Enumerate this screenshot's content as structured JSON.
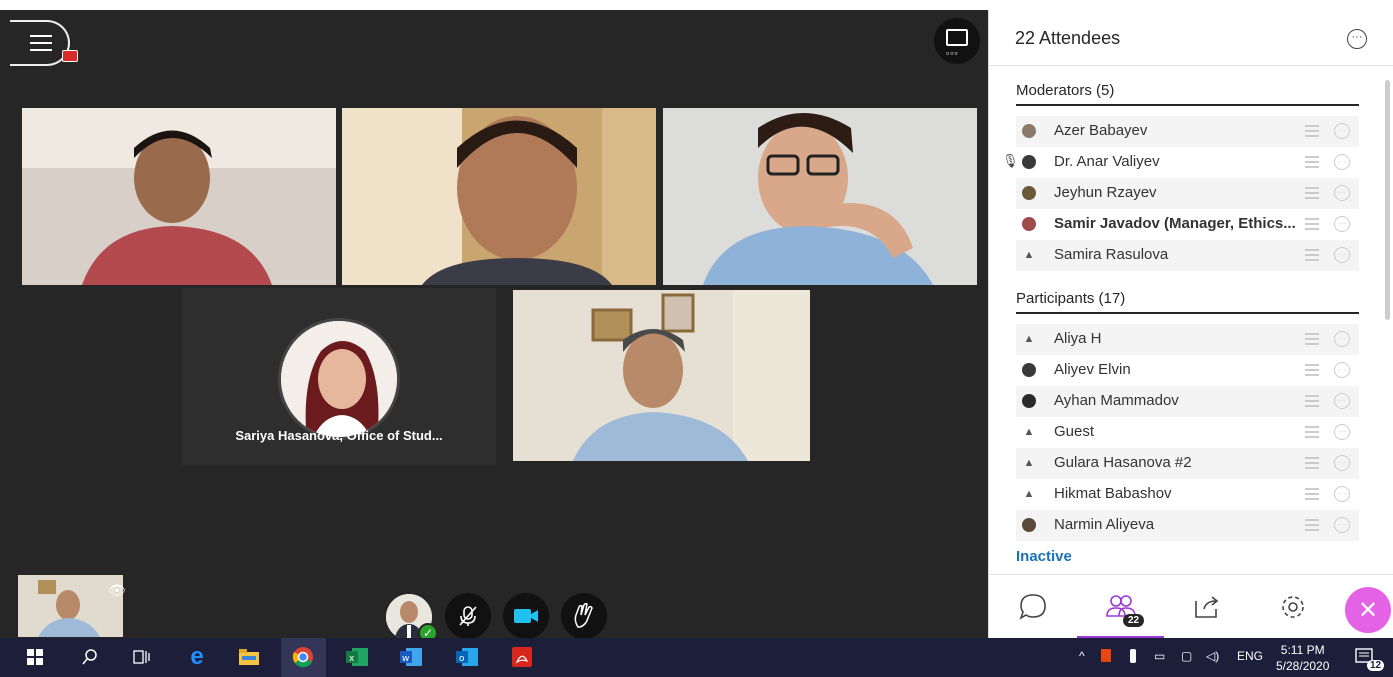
{
  "meeting": {
    "tiles": [
      {
        "kind": "video",
        "bg": "#8a7c72"
      },
      {
        "kind": "video",
        "bg": "#a88a5c"
      },
      {
        "kind": "video",
        "bg": "#c8c9c7"
      },
      {
        "kind": "avatar",
        "name": "Sariya Hasanova, Office of Stud..."
      },
      {
        "kind": "video",
        "bg": "#d8d3c6"
      }
    ],
    "controls": {
      "mic_icon": "mic-off-icon",
      "camera_icon": "camera-icon",
      "hand_icon": "raise-hand-icon"
    }
  },
  "panel": {
    "title": "22 Attendees",
    "moderators_label": "Moderators (5)",
    "moderators": [
      {
        "name": "Azer Babayev",
        "bold": false,
        "avatar": "#8a7a6a",
        "mic": false
      },
      {
        "name": "Dr. Anar Valiyev",
        "bold": false,
        "avatar": "#3a3a3a",
        "mic": true
      },
      {
        "name": "Jeyhun Rzayev",
        "bold": false,
        "avatar": "#6a5a3a",
        "mic": false
      },
      {
        "name": "Samir Javadov (Manager, Ethics...",
        "bold": true,
        "avatar": "#a04a4a",
        "mic": false
      },
      {
        "name": "Samira Rasulova",
        "bold": false,
        "avatar": "generic",
        "mic": false
      }
    ],
    "participants_label": "Participants (17)",
    "participants": [
      {
        "name": "Aliya H",
        "bold": false,
        "avatar": "generic"
      },
      {
        "name": "Aliyev Elvin",
        "bold": false,
        "avatar": "#3a3a3a"
      },
      {
        "name": "Ayhan Mammadov",
        "bold": false,
        "avatar": "#2a2a2a"
      },
      {
        "name": "Guest",
        "bold": false,
        "avatar": "generic"
      },
      {
        "name": "Gulara Hasanova #2",
        "bold": false,
        "avatar": "generic"
      },
      {
        "name": "Hikmat Babashov",
        "bold": false,
        "avatar": "generic"
      },
      {
        "name": "Narmin Aliyeva",
        "bold": false,
        "avatar": "#5a4a3a"
      }
    ],
    "inactive_label": "Inactive",
    "attendee_badge": "22"
  },
  "taskbar": {
    "language": "ENG",
    "time": "5:11 PM",
    "date": "5/28/2020",
    "notifications": "12"
  }
}
